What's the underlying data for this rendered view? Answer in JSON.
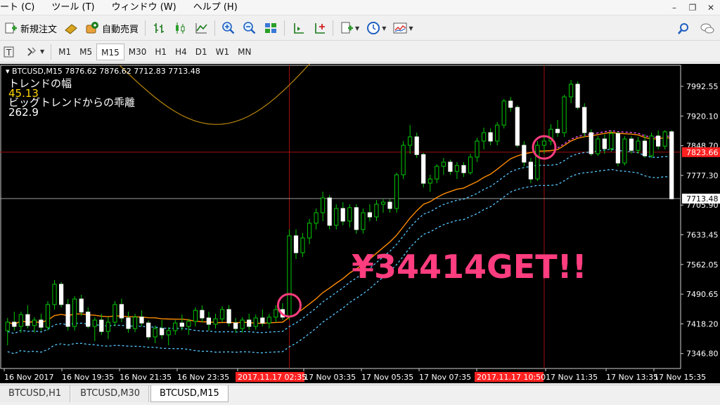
{
  "menu": {
    "items": [
      "ート (C)",
      "ツール (T)",
      "ウィンドウ (W)",
      "ヘルプ (H)"
    ]
  },
  "toolbar": {
    "new_order_label": "新規注文",
    "auto_trade_label": "自動売買"
  },
  "timeframes": [
    "M1",
    "M5",
    "M15",
    "M30",
    "H1",
    "H4",
    "D1",
    "W1",
    "MN"
  ],
  "active_timeframe": "M15",
  "chart": {
    "symbol_info": "BTCUSD,M15  7876.62 7876.62 7712.83 7713.48",
    "ind_label_1": "トレンドの幅",
    "ind_value_1": "45.13",
    "ind_label_2": "ビッグトレンドからの乖離",
    "ind_value_2": "262.9",
    "annotation": "¥34414GET!!",
    "current_price": "7713.48",
    "crosshair_price": "7823.66",
    "colors": {
      "bull": "#00c800",
      "bear": "#ffffff",
      "ma": "#ff8c00",
      "band": "#55c8ff",
      "band2": "#ff55ff",
      "annotation": "#ff3d7f",
      "price_marker": "#ff2020"
    }
  },
  "chart_data": {
    "type": "candlestick",
    "price_ticks": [
      "7992.55",
      "7920.10",
      "7848.70",
      "7777.30",
      "7705.90",
      "7633.45",
      "7562.05",
      "7490.65",
      "7418.20",
      "7346.80"
    ],
    "time_labels": [
      "16 Nov 2017",
      "16 Nov 19:35",
      "16 Nov 21:35",
      "16 Nov 23:35",
      "2017.11.17 02:35",
      "17 Nov 03:35",
      "17 Nov 05:35",
      "17 Nov 07:35",
      "2017.11.17 10:50",
      "17 Nov 11:35",
      "17 Nov 13:35",
      "17 Nov 15:35"
    ],
    "highlighted_times": [
      "2017.11.17 02:35",
      "2017.11.17 10:50"
    ],
    "ylim": [
      7310,
      8030
    ],
    "candles": [
      [
        7400,
        7430,
        7365,
        7420
      ],
      [
        7420,
        7445,
        7400,
        7410
      ],
      [
        7410,
        7445,
        7395,
        7438
      ],
      [
        7438,
        7460,
        7405,
        7412
      ],
      [
        7412,
        7432,
        7395,
        7425
      ],
      [
        7425,
        7440,
        7400,
        7408
      ],
      [
        7408,
        7470,
        7400,
        7462
      ],
      [
        7462,
        7520,
        7450,
        7510
      ],
      [
        7510,
        7515,
        7455,
        7462
      ],
      [
        7462,
        7475,
        7400,
        7410
      ],
      [
        7410,
        7482,
        7400,
        7475
      ],
      [
        7475,
        7485,
        7435,
        7444
      ],
      [
        7444,
        7455,
        7405,
        7410
      ],
      [
        7410,
        7432,
        7375,
        7425
      ],
      [
        7425,
        7440,
        7390,
        7398
      ],
      [
        7398,
        7432,
        7380,
        7420
      ],
      [
        7420,
        7470,
        7410,
        7462
      ],
      [
        7462,
        7476,
        7420,
        7430
      ],
      [
        7430,
        7445,
        7395,
        7405
      ],
      [
        7405,
        7440,
        7396,
        7432
      ],
      [
        7432,
        7448,
        7410,
        7418
      ],
      [
        7418,
        7424,
        7378,
        7385
      ],
      [
        7385,
        7412,
        7370,
        7405
      ],
      [
        7405,
        7425,
        7380,
        7390
      ],
      [
        7390,
        7408,
        7365,
        7400
      ],
      [
        7400,
        7425,
        7390,
        7418
      ],
      [
        7418,
        7438,
        7400,
        7410
      ],
      [
        7410,
        7428,
        7390,
        7422
      ],
      [
        7422,
        7455,
        7410,
        7448
      ],
      [
        7448,
        7460,
        7420,
        7430
      ],
      [
        7430,
        7445,
        7400,
        7415
      ],
      [
        7415,
        7440,
        7405,
        7428
      ],
      [
        7428,
        7458,
        7420,
        7450
      ],
      [
        7450,
        7460,
        7410,
        7418
      ],
      [
        7418,
        7430,
        7395,
        7405
      ],
      [
        7405,
        7432,
        7395,
        7425
      ],
      [
        7425,
        7440,
        7402,
        7410
      ],
      [
        7410,
        7438,
        7402,
        7430
      ],
      [
        7430,
        7450,
        7410,
        7418
      ],
      [
        7418,
        7440,
        7405,
        7432
      ],
      [
        7432,
        7460,
        7420,
        7450
      ],
      [
        7450,
        7465,
        7425,
        7432
      ],
      [
        7432,
        7640,
        7425,
        7625
      ],
      [
        7625,
        7640,
        7570,
        7585
      ],
      [
        7585,
        7632,
        7575,
        7620
      ],
      [
        7620,
        7665,
        7605,
        7655
      ],
      [
        7655,
        7690,
        7640,
        7680
      ],
      [
        7680,
        7730,
        7660,
        7715
      ],
      [
        7715,
        7722,
        7640,
        7650
      ],
      [
        7650,
        7700,
        7640,
        7690
      ],
      [
        7690,
        7705,
        7650,
        7660
      ],
      [
        7660,
        7700,
        7645,
        7692
      ],
      [
        7692,
        7700,
        7630,
        7640
      ],
      [
        7640,
        7690,
        7630,
        7680
      ],
      [
        7680,
        7700,
        7660,
        7670
      ],
      [
        7670,
        7710,
        7660,
        7700
      ],
      [
        7700,
        7712,
        7680,
        7705
      ],
      [
        7705,
        7712,
        7680,
        7690
      ],
      [
        7690,
        7775,
        7680,
        7770
      ],
      [
        7770,
        7850,
        7760,
        7840
      ],
      [
        7840,
        7888,
        7820,
        7860
      ],
      [
        7860,
        7870,
        7810,
        7818
      ],
      [
        7818,
        7822,
        7740,
        7750
      ],
      [
        7750,
        7770,
        7730,
        7760
      ],
      [
        7760,
        7795,
        7750,
        7790
      ],
      [
        7790,
        7810,
        7770,
        7800
      ],
      [
        7800,
        7806,
        7770,
        7778
      ],
      [
        7778,
        7800,
        7760,
        7792
      ],
      [
        7792,
        7800,
        7765,
        7775
      ],
      [
        7775,
        7820,
        7770,
        7812
      ],
      [
        7812,
        7858,
        7800,
        7850
      ],
      [
        7850,
        7882,
        7830,
        7870
      ],
      [
        7870,
        7880,
        7840,
        7850
      ],
      [
        7850,
        7895,
        7840,
        7888
      ],
      [
        7888,
        7950,
        7880,
        7945
      ],
      [
        7945,
        7955,
        7920,
        7930
      ],
      [
        7930,
        7935,
        7835,
        7840
      ],
      [
        7840,
        7850,
        7790,
        7800
      ],
      [
        7800,
        7810,
        7750,
        7760
      ],
      [
        7760,
        7850,
        7755,
        7840
      ],
      [
        7840,
        7862,
        7820,
        7850
      ],
      [
        7850,
        7890,
        7840,
        7878
      ],
      [
        7878,
        7900,
        7860,
        7870
      ],
      [
        7870,
        7960,
        7860,
        7955
      ],
      [
        7955,
        7995,
        7940,
        7985
      ],
      [
        7985,
        7992,
        7925,
        7930
      ],
      [
        7930,
        7940,
        7860,
        7870
      ],
      [
        7870,
        7878,
        7815,
        7820
      ],
      [
        7820,
        7862,
        7815,
        7855
      ],
      [
        7855,
        7866,
        7820,
        7832
      ],
      [
        7832,
        7875,
        7825,
        7868
      ],
      [
        7868,
        7872,
        7790,
        7798
      ],
      [
        7798,
        7862,
        7792,
        7855
      ],
      [
        7855,
        7862,
        7820,
        7828
      ],
      [
        7828,
        7860,
        7820,
        7850
      ],
      [
        7850,
        7866,
        7810,
        7815
      ],
      [
        7815,
        7870,
        7810,
        7862
      ],
      [
        7862,
        7875,
        7830,
        7838
      ],
      [
        7838,
        7876,
        7830,
        7872
      ],
      [
        7872,
        7876,
        7712,
        7713
      ]
    ]
  },
  "bottom_tabs": [
    "BTCUSD,H1",
    "BTCUSD,M30",
    "BTCUSD,M15"
  ],
  "active_tab": "BTCUSD,M15"
}
